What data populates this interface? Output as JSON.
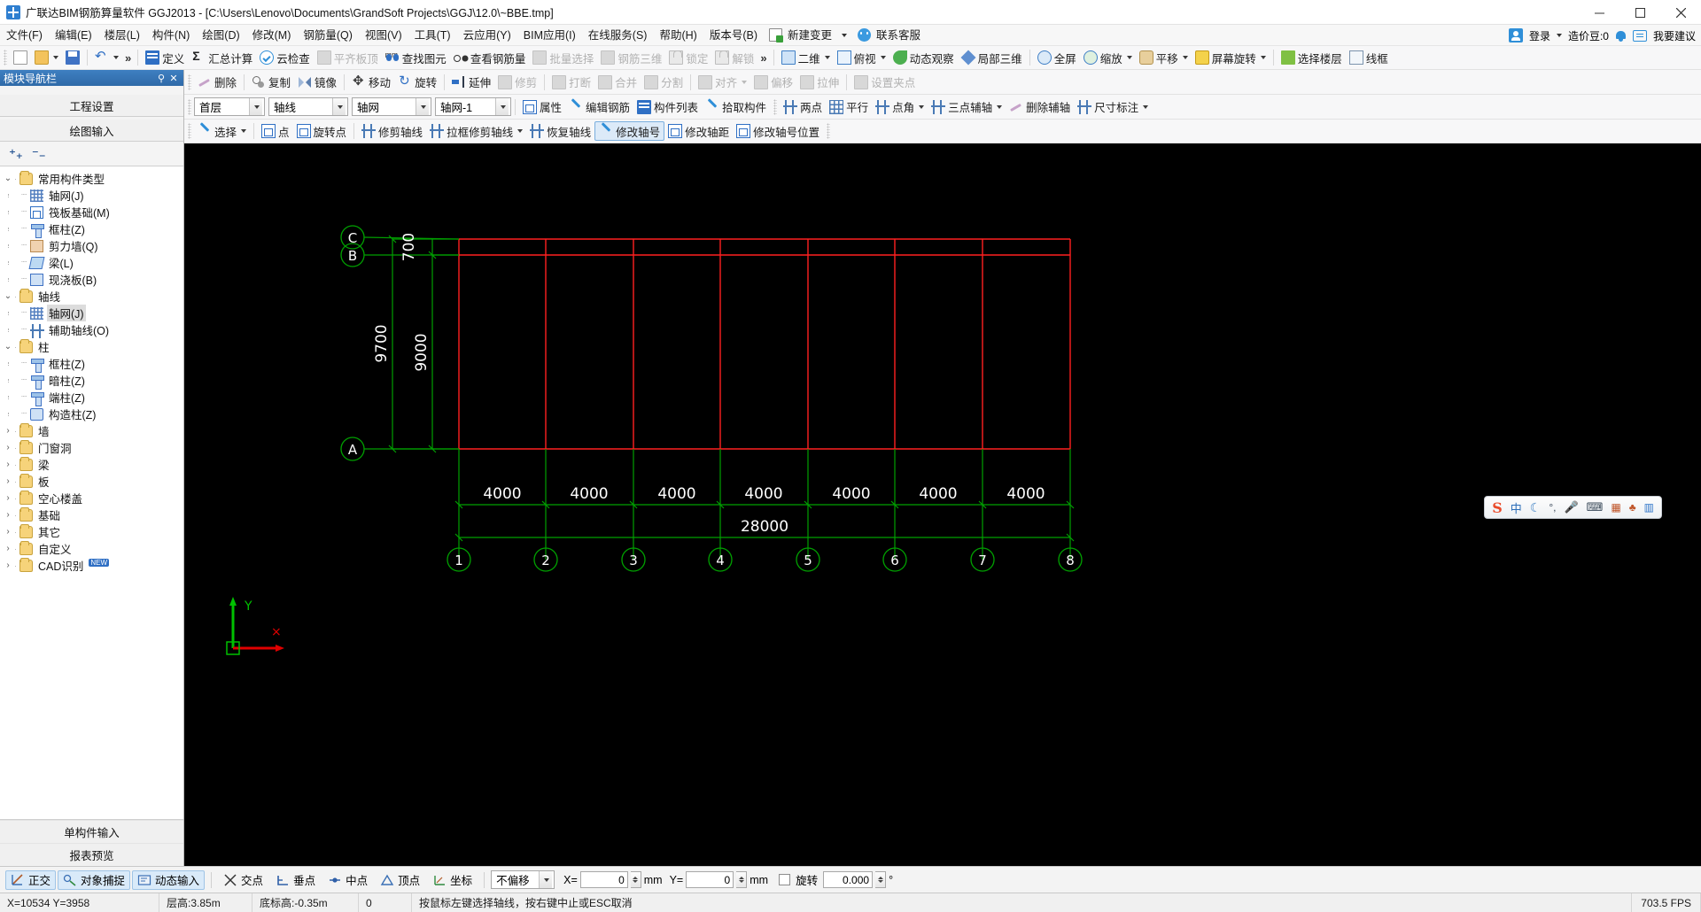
{
  "window": {
    "title": "广联达BIM钢筋算量软件 GGJ2013 - [C:\\Users\\Lenovo\\Documents\\GrandSoft Projects\\GGJ\\12.0\\~BBE.tmp]",
    "minimize": "—",
    "maximize": "▢",
    "close": "✕"
  },
  "menubar": {
    "items": [
      "文件(F)",
      "编辑(E)",
      "楼层(L)",
      "构件(N)",
      "绘图(D)",
      "修改(M)",
      "钢筋量(Q)",
      "视图(V)",
      "工具(T)",
      "云应用(Y)",
      "BIM应用(I)",
      "在线服务(S)",
      "帮助(H)",
      "版本号(B)"
    ],
    "new_change": "新建变更",
    "contact": "联系客服",
    "login": "登录",
    "coin": "造价豆:0",
    "feedback": "我要建议"
  },
  "toolbar_main": {
    "items": [
      {
        "label": "",
        "icon": "new-doc-icon",
        "disabled": false
      },
      {
        "label": "",
        "icon": "open-folder-icon",
        "disabled": false,
        "dropdown": true
      },
      {
        "label": "",
        "icon": "save-icon",
        "disabled": false
      },
      {
        "label": "",
        "icon": "undo-icon",
        "disabled": false,
        "dropdown": true
      },
      {
        "label": "定义",
        "icon": "define-icon",
        "disabled": false
      },
      {
        "label": "汇总计算",
        "icon": "sigma-icon",
        "disabled": false
      },
      {
        "label": "云检查",
        "icon": "cloud-check-icon",
        "disabled": false
      },
      {
        "label": "平齐板顶",
        "icon": "align-slab-icon",
        "disabled": true
      },
      {
        "label": "查找图元",
        "icon": "binoculars-icon",
        "disabled": false
      },
      {
        "label": "查看钢筋量",
        "icon": "glasses-icon",
        "disabled": false
      },
      {
        "label": "批量选择",
        "icon": "batch-select-icon",
        "disabled": true
      },
      {
        "label": "钢筋三维",
        "icon": "rebar-3d-icon",
        "disabled": true
      },
      {
        "label": "锁定",
        "icon": "lock-icon",
        "disabled": true
      },
      {
        "label": "解锁",
        "icon": "unlock-icon",
        "disabled": true
      }
    ],
    "overflow": "»",
    "view_items": [
      {
        "label": "二维",
        "icon": "2d-icon",
        "dropdown": true
      },
      {
        "label": "俯视",
        "icon": "cube-icon",
        "dropdown": true
      },
      {
        "label": "动态观察",
        "icon": "orbit-icon"
      },
      {
        "label": "局部三维",
        "icon": "local-3d-icon"
      },
      {
        "label": "全屏",
        "icon": "fullscreen-icon"
      },
      {
        "label": "缩放",
        "icon": "zoom-icon",
        "dropdown": true
      },
      {
        "label": "平移",
        "icon": "pan-icon",
        "dropdown": true
      },
      {
        "label": "屏幕旋转",
        "icon": "screen-rotate-icon",
        "dropdown": true
      },
      {
        "label": "选择楼层",
        "icon": "select-floor-icon"
      },
      {
        "label": "线框",
        "icon": "wireframe-icon"
      }
    ]
  },
  "toolbar_edit": {
    "items": [
      {
        "label": "删除",
        "icon": "delete-icon",
        "disabled": false
      },
      {
        "label": "复制",
        "icon": "copy-icon",
        "disabled": false
      },
      {
        "label": "镜像",
        "icon": "mirror-icon",
        "disabled": false
      },
      {
        "label": "移动",
        "icon": "move-icon",
        "disabled": false
      },
      {
        "label": "旋转",
        "icon": "rotate-icon",
        "disabled": false
      },
      {
        "label": "延伸",
        "icon": "extend-icon",
        "disabled": false
      },
      {
        "label": "修剪",
        "icon": "trim-icon",
        "disabled": true
      },
      {
        "label": "打断",
        "icon": "break-icon",
        "disabled": true
      },
      {
        "label": "合并",
        "icon": "merge-icon",
        "disabled": true
      },
      {
        "label": "分割",
        "icon": "split-icon",
        "disabled": true
      },
      {
        "label": "对齐",
        "icon": "align-icon",
        "disabled": true,
        "dropdown": true
      },
      {
        "label": "偏移",
        "icon": "offset-icon",
        "disabled": true
      },
      {
        "label": "拉伸",
        "icon": "stretch-icon",
        "disabled": true
      },
      {
        "label": "设置夹点",
        "icon": "set-grip-icon",
        "disabled": true
      }
    ]
  },
  "toolbar_props": {
    "selectors": [
      {
        "name": "floor-select",
        "value": "首层"
      },
      {
        "name": "category-select",
        "value": "轴线"
      },
      {
        "name": "component-type-select",
        "value": "轴网"
      },
      {
        "name": "component-select",
        "value": "轴网-1"
      }
    ],
    "buttons": [
      {
        "label": "属性",
        "icon": "properties-icon"
      },
      {
        "label": "编辑钢筋",
        "icon": "edit-rebar-icon"
      },
      {
        "label": "构件列表",
        "icon": "component-list-icon"
      },
      {
        "label": "拾取构件",
        "icon": "pick-component-icon"
      }
    ],
    "axis_buttons": [
      {
        "label": "两点",
        "icon": "two-point-icon"
      },
      {
        "label": "平行",
        "icon": "parallel-icon"
      },
      {
        "label": "点角",
        "icon": "point-angle-icon",
        "dropdown": true
      },
      {
        "label": "三点辅轴",
        "icon": "three-point-aux-icon",
        "dropdown": true
      },
      {
        "label": "删除辅轴",
        "icon": "delete-aux-icon"
      },
      {
        "label": "尺寸标注",
        "icon": "dimension-icon",
        "dropdown": true
      }
    ]
  },
  "toolbar_axis": {
    "items": [
      {
        "label": "选择",
        "icon": "cursor-icon",
        "dropdown": true,
        "selected": false
      },
      {
        "label": "点",
        "icon": "point-icon",
        "selected": false
      },
      {
        "label": "旋转点",
        "icon": "rotate-point-icon",
        "selected": false
      },
      {
        "label": "修剪轴线",
        "icon": "trim-axis-icon",
        "selected": false
      },
      {
        "label": "拉框修剪轴线",
        "icon": "box-trim-axis-icon",
        "dropdown": true,
        "selected": false
      },
      {
        "label": "恢复轴线",
        "icon": "restore-axis-icon",
        "selected": false
      },
      {
        "label": "修改轴号",
        "icon": "edit-axis-number-icon",
        "selected": true
      },
      {
        "label": "修改轴距",
        "icon": "edit-axis-spacing-icon",
        "selected": false
      },
      {
        "label": "修改轴号位置",
        "icon": "edit-axis-number-position-icon",
        "selected": false
      }
    ]
  },
  "sidebar": {
    "title": "模块导航栏",
    "pin": "⚲",
    "close": "✕",
    "buttons": [
      "工程设置",
      "绘图输入"
    ],
    "tools": {
      "expand_all": "expand-all-icon",
      "collapse_all": "collapse-all-icon"
    },
    "tree": [
      {
        "level": 0,
        "label": "常用构件类型",
        "icon": "folder-icon",
        "expand": "v"
      },
      {
        "level": 1,
        "label": "轴网(J)",
        "icon": "grid-icon"
      },
      {
        "level": 1,
        "label": "筏板基础(M)",
        "icon": "raft-foundation-icon"
      },
      {
        "level": 1,
        "label": "框柱(Z)",
        "icon": "frame-column-icon"
      },
      {
        "level": 1,
        "label": "剪力墙(Q)",
        "icon": "shear-wall-icon"
      },
      {
        "level": 1,
        "label": "梁(L)",
        "icon": "beam-icon"
      },
      {
        "level": 1,
        "label": "现浇板(B)",
        "icon": "cast-slab-icon"
      },
      {
        "level": 0,
        "label": "轴线",
        "icon": "folder-icon",
        "expand": "v"
      },
      {
        "level": 1,
        "label": "轴网(J)",
        "icon": "grid-icon",
        "selected": true
      },
      {
        "level": 1,
        "label": "辅助轴线(O)",
        "icon": "aux-axis-icon"
      },
      {
        "level": 0,
        "label": "柱",
        "icon": "folder-icon",
        "expand": "v"
      },
      {
        "level": 1,
        "label": "框柱(Z)",
        "icon": "frame-column-icon"
      },
      {
        "level": 1,
        "label": "暗柱(Z)",
        "icon": "hidden-column-icon"
      },
      {
        "level": 1,
        "label": "端柱(Z)",
        "icon": "end-column-icon"
      },
      {
        "level": 1,
        "label": "构造柱(Z)",
        "icon": "constructional-column-icon"
      },
      {
        "level": 0,
        "label": "墙",
        "icon": "folder-icon",
        "expand": ">"
      },
      {
        "level": 0,
        "label": "门窗洞",
        "icon": "folder-icon",
        "expand": ">"
      },
      {
        "level": 0,
        "label": "梁",
        "icon": "folder-icon",
        "expand": ">"
      },
      {
        "level": 0,
        "label": "板",
        "icon": "folder-icon",
        "expand": ">"
      },
      {
        "level": 0,
        "label": "空心楼盖",
        "icon": "folder-icon",
        "expand": ">"
      },
      {
        "level": 0,
        "label": "基础",
        "icon": "folder-icon",
        "expand": ">"
      },
      {
        "level": 0,
        "label": "其它",
        "icon": "folder-icon",
        "expand": ">"
      },
      {
        "level": 0,
        "label": "自定义",
        "icon": "folder-icon",
        "expand": ">"
      },
      {
        "level": 0,
        "label": "CAD识别",
        "icon": "folder-icon",
        "expand": ">",
        "badge": "NEW"
      }
    ],
    "bottom_buttons": [
      "单构件输入",
      "报表预览"
    ]
  },
  "canvas": {
    "background": "#000000",
    "axis_color_red": "#ff2020",
    "axis_color_green": "#00b000",
    "dim_text_color": "#ffffff",
    "vertical_labels": [
      "C",
      "B",
      "A"
    ],
    "horizontal_labels": [
      "1",
      "2",
      "3",
      "4",
      "5",
      "6",
      "7",
      "8"
    ],
    "vertical_dims": [
      "700",
      "9000",
      "9700"
    ],
    "horizontal_dims": [
      "4000",
      "4000",
      "4000",
      "4000",
      "4000",
      "4000",
      "4000"
    ],
    "total_dim": "28000",
    "axis_marker_x": "X",
    "axis_marker_y": "Y"
  },
  "ime": {
    "logo": "S",
    "mode": "中",
    "moon": "☾",
    "punct": "°,",
    "mic": "mic-icon",
    "keyboard": "keyboard-icon",
    "toolbox": "toolbox-icon",
    "skin": "skin-icon",
    "apps": "apps-icon"
  },
  "optionbar": {
    "toggles": [
      {
        "label": "正交",
        "icon": "ortho-icon",
        "active": true
      },
      {
        "label": "对象捕捉",
        "icon": "object-snap-icon",
        "active": true
      },
      {
        "label": "动态输入",
        "icon": "dynamic-input-icon",
        "active": true
      }
    ],
    "snaps": [
      {
        "label": "交点",
        "icon": "intersection-icon"
      },
      {
        "label": "垂点",
        "icon": "perpendicular-icon"
      },
      {
        "label": "中点",
        "icon": "midpoint-icon"
      },
      {
        "label": "顶点",
        "icon": "vertex-icon"
      },
      {
        "label": "坐标",
        "icon": "coordinate-icon"
      }
    ],
    "offset_select": "不偏移",
    "x_label": "X=",
    "x_value": "0",
    "x_unit": "mm",
    "y_label": "Y=",
    "y_value": "0",
    "y_unit": "mm",
    "rotate_checkbox": false,
    "rotate_label": "旋转",
    "rotate_value": "0.000",
    "rotate_unit": "°"
  },
  "statusbar": {
    "coords": "X=10534  Y=3958",
    "floor_height": "层高:3.85m",
    "base_height": "底标高:-0.35m",
    "zero": "0",
    "hint": "按鼠标左键选择轴线，按右键中止或ESC取消",
    "fps": "703.5 FPS"
  }
}
